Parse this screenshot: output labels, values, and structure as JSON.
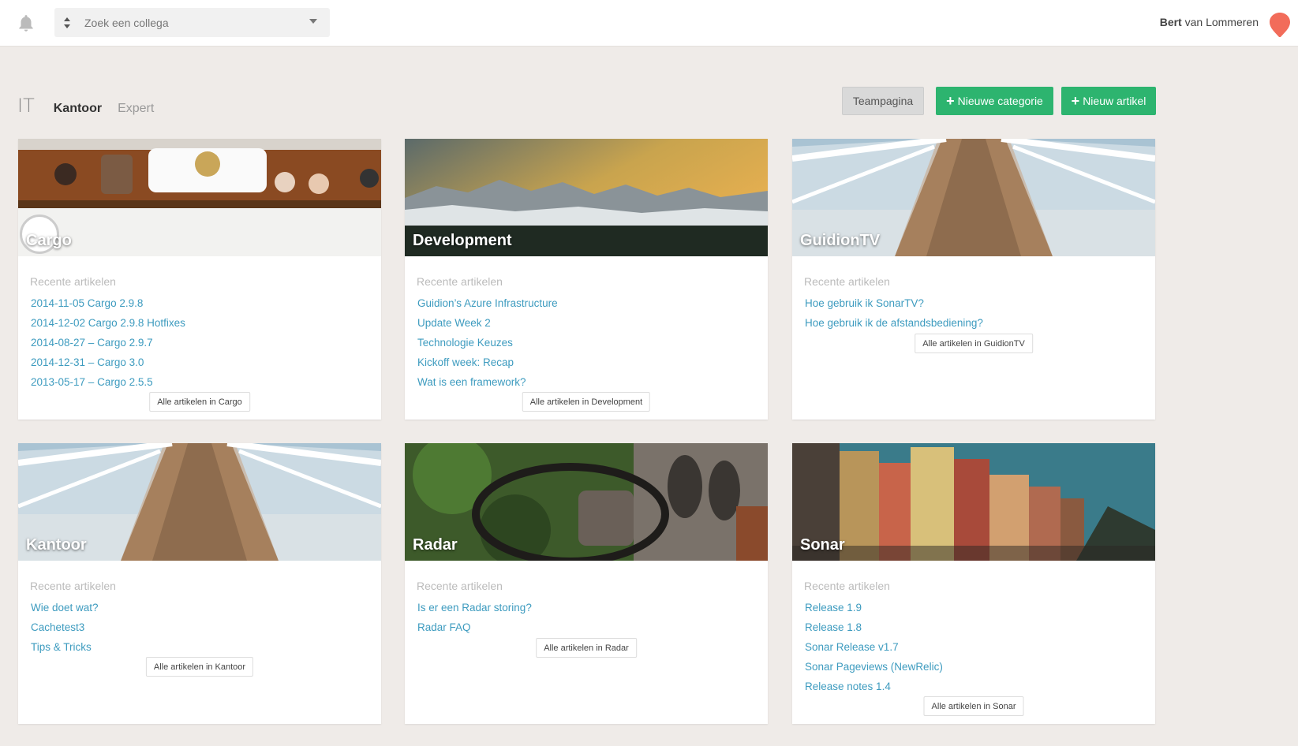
{
  "topbar": {
    "search_placeholder": "Zoek een collega",
    "user_first": "Bert",
    "user_rest": " van Lommeren"
  },
  "tabs": {
    "it": "IT",
    "kantoor": "Kantoor",
    "expert": "Expert"
  },
  "actions": {
    "teampagina": "Teampagina",
    "nieuwe_categorie": "Nieuwe categorie",
    "nieuw_artikel": "Nieuw artikel"
  },
  "colors": {
    "accent_green": "#2db46f",
    "link_blue": "#3d9bbf",
    "background": "#efebe8",
    "avatar": "#f26c5a"
  },
  "cards": [
    {
      "title": "Cargo",
      "recent_label": "Recente artikelen",
      "articles": [
        "2014-11-05 Cargo 2.9.8",
        "2014-12-02 Cargo 2.9.8 Hotfixes",
        "2014-08-27 – Cargo 2.9.7",
        "2014-12-31 – Cargo 3.0",
        "2013-05-17 – Cargo 2.5.5"
      ],
      "all_label": "Alle artikelen in Cargo"
    },
    {
      "title": "Development",
      "recent_label": "Recente artikelen",
      "articles": [
        "Guidion’s Azure Infrastructure",
        "Update Week 2",
        "Technologie Keuzes",
        "Kickoff week: Recap",
        "Wat is een framework?"
      ],
      "all_label": "Alle artikelen in Development"
    },
    {
      "title": "GuidionTV",
      "recent_label": "Recente artikelen",
      "articles": [
        "Hoe gebruik ik SonarTV?",
        "Hoe gebruik ik de afstandsbediening?"
      ],
      "all_label": "Alle artikelen in GuidionTV"
    },
    {
      "title": "Kantoor",
      "recent_label": "Recente artikelen",
      "articles": [
        "Wie doet wat?",
        "Cachetest3",
        "Tips & Tricks"
      ],
      "all_label": "Alle artikelen in Kantoor"
    },
    {
      "title": "Radar",
      "recent_label": "Recente artikelen",
      "articles": [
        "Is er een Radar storing?",
        "Radar FAQ"
      ],
      "all_label": "Alle artikelen in Radar"
    },
    {
      "title": "Sonar",
      "recent_label": "Recente artikelen",
      "articles": [
        "Release 1.9",
        "Release 1.8",
        "Sonar Release v1.7",
        "Sonar Pageviews (NewRelic)",
        "Release notes 1.4"
      ],
      "all_label": "Alle artikelen in Sonar"
    }
  ]
}
